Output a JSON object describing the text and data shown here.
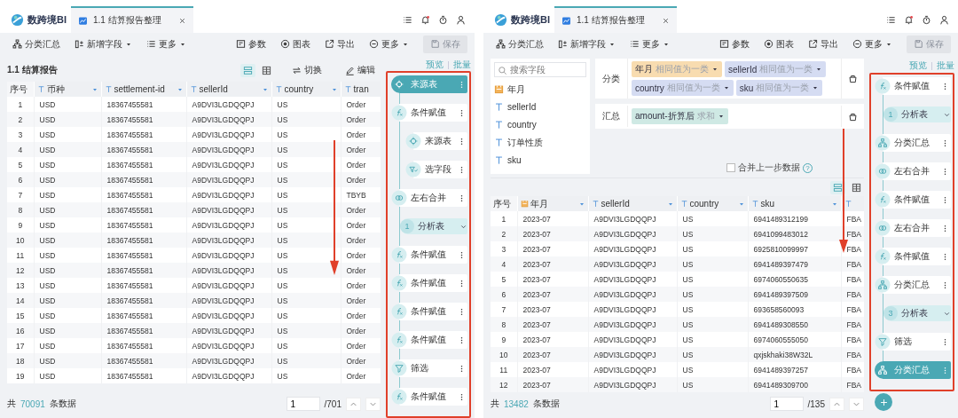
{
  "panels": [
    {
      "app_name": "数跨境BI",
      "tab": {
        "label": "1.1 结算报告整理",
        "selected": true
      },
      "toolbar": {
        "left": [
          {
            "label": "分类汇总",
            "kind": "group",
            "dropdown": false
          },
          {
            "label": "新增字段",
            "kind": "add-field",
            "dropdown": true
          },
          {
            "label": "更多",
            "kind": "more-list",
            "dropdown": true
          }
        ],
        "right": [
          {
            "label": "参数",
            "kind": "params",
            "dropdown": false
          },
          {
            "label": "图表",
            "kind": "chart",
            "dropdown": false
          },
          {
            "label": "导出",
            "kind": "export",
            "dropdown": false
          },
          {
            "label": "更多",
            "kind": "more-circle",
            "dropdown": true
          }
        ],
        "save": {
          "label": "保存",
          "disabled": true
        }
      },
      "report": {
        "title": "1.1 结算报告",
        "actions": [
          {
            "label": "切换",
            "kind": "switch"
          },
          {
            "label": "编辑",
            "kind": "edit"
          }
        ]
      },
      "table": {
        "views": [
          {
            "selected": true
          },
          {
            "selected": false
          }
        ],
        "columns": [
          {
            "label": "序号",
            "kind": "index",
            "menu": false
          },
          {
            "label": "币种",
            "kind": "text",
            "menu": true
          },
          {
            "label": "settlement-id",
            "kind": "text",
            "menu": true
          },
          {
            "label": "sellerId",
            "kind": "text",
            "menu": true
          },
          {
            "label": "country",
            "kind": "text",
            "menu": true
          },
          {
            "label": "tran",
            "kind": "text",
            "menu": false
          }
        ],
        "rows": [
          [
            "1",
            "USD",
            "18367455581",
            "A9DVI3LGDQQPJ",
            "US",
            "Order"
          ],
          [
            "2",
            "USD",
            "18367455581",
            "A9DVI3LGDQQPJ",
            "US",
            "Order"
          ],
          [
            "3",
            "USD",
            "18367455581",
            "A9DVI3LGDQQPJ",
            "US",
            "Order"
          ],
          [
            "4",
            "USD",
            "18367455581",
            "A9DVI3LGDQQPJ",
            "US",
            "Order"
          ],
          [
            "5",
            "USD",
            "18367455581",
            "A9DVI3LGDQQPJ",
            "US",
            "Order"
          ],
          [
            "6",
            "USD",
            "18367455581",
            "A9DVI3LGDQQPJ",
            "US",
            "Order"
          ],
          [
            "7",
            "USD",
            "18367455581",
            "A9DVI3LGDQQPJ",
            "US",
            "TBYB"
          ],
          [
            "8",
            "USD",
            "18367455581",
            "A9DVI3LGDQQPJ",
            "US",
            "Order"
          ],
          [
            "9",
            "USD",
            "18367455581",
            "A9DVI3LGDQQPJ",
            "US",
            "Order"
          ],
          [
            "10",
            "USD",
            "18367455581",
            "A9DVI3LGDQQPJ",
            "US",
            "Order"
          ],
          [
            "11",
            "USD",
            "18367455581",
            "A9DVI3LGDQQPJ",
            "US",
            "Order"
          ],
          [
            "12",
            "USD",
            "18367455581",
            "A9DVI3LGDQQPJ",
            "US",
            "Order"
          ],
          [
            "13",
            "USD",
            "18367455581",
            "A9DVI3LGDQQPJ",
            "US",
            "Order"
          ],
          [
            "14",
            "USD",
            "18367455581",
            "A9DVI3LGDQQPJ",
            "US",
            "Order"
          ],
          [
            "15",
            "USD",
            "18367455581",
            "A9DVI3LGDQQPJ",
            "US",
            "Order"
          ],
          [
            "16",
            "USD",
            "18367455581",
            "A9DVI3LGDQQPJ",
            "US",
            "Order"
          ],
          [
            "17",
            "USD",
            "18367455581",
            "A9DVI3LGDQQPJ",
            "US",
            "Order"
          ],
          [
            "18",
            "USD",
            "18367455581",
            "A9DVI3LGDQQPJ",
            "US",
            "Order"
          ],
          [
            "19",
            "USD",
            "18367455581",
            "A9DVI3LGDQQPJ",
            "US",
            "Order"
          ]
        ]
      },
      "footer": {
        "prefix": "共",
        "count": "70091",
        "suffix": "条数据",
        "page": "1",
        "pages": "/701"
      },
      "flow": {
        "links": [
          "预览",
          "批量"
        ],
        "nodes": [
          {
            "label": "来源表",
            "kind": "source",
            "selected": true
          },
          {
            "label": "条件赋值",
            "kind": "assign",
            "selected": false,
            "children": [
              {
                "label": "来源表",
                "kind": "source",
                "selected": false
              },
              {
                "label": "选字段",
                "kind": "select",
                "selected": false
              }
            ]
          },
          {
            "label": "左右合并",
            "kind": "merge",
            "selected": false
          },
          {
            "label": "分析表",
            "number": "1",
            "kind": "table",
            "selected": false
          },
          {
            "label": "条件赋值",
            "kind": "assign",
            "selected": false
          },
          {
            "label": "条件赋值",
            "kind": "assign",
            "selected": false
          },
          {
            "label": "条件赋值",
            "kind": "assign",
            "selected": false
          },
          {
            "label": "条件赋值",
            "kind": "assign",
            "selected": false
          },
          {
            "label": "筛选",
            "kind": "filter",
            "selected": false
          },
          {
            "label": "条件赋值",
            "kind": "assign",
            "selected": false
          }
        ]
      }
    },
    {
      "app_name": "数跨境BI",
      "tab": {
        "label": "1.1 结算报告整理",
        "selected": true
      },
      "toolbar": {
        "left": [
          {
            "label": "分类汇总",
            "kind": "group",
            "dropdown": false
          },
          {
            "label": "新增字段",
            "kind": "add-field",
            "dropdown": true
          },
          {
            "label": "更多",
            "kind": "more-list",
            "dropdown": true
          }
        ],
        "right": [
          {
            "label": "参数",
            "kind": "params",
            "dropdown": false
          },
          {
            "label": "图表",
            "kind": "chart",
            "dropdown": false
          },
          {
            "label": "导出",
            "kind": "export",
            "dropdown": false
          },
          {
            "label": "更多",
            "kind": "more-circle",
            "dropdown": true
          }
        ],
        "save": {
          "label": "保存",
          "disabled": true
        }
      },
      "fields": {
        "placeholder": "搜索字段",
        "items": [
          {
            "label": "年月",
            "kind": "date"
          },
          {
            "label": "sellerId",
            "kind": "text"
          },
          {
            "label": "country",
            "kind": "text"
          },
          {
            "label": "订单性质",
            "kind": "text"
          },
          {
            "label": "sku",
            "kind": "text"
          }
        ]
      },
      "config": {
        "rows": [
          {
            "label": "分类",
            "chips": [
              {
                "label": "年月",
                "note": "相同值为一类",
                "color": "#f8dcb0"
              },
              {
                "label": "sellerId",
                "note": "相同值为一类",
                "color": "#d5dcf2"
              },
              {
                "label": "country",
                "note": "相同值为一类",
                "color": "#d5dcf2"
              },
              {
                "label": "sku",
                "note": "相同值为一类",
                "color": "#d5dcf2"
              }
            ]
          },
          {
            "label": "汇总",
            "chips": [
              {
                "label": "amount-折算后",
                "note": "求和",
                "color": "#cfe9e4"
              }
            ]
          }
        ],
        "merge": {
          "label": "合并上一步数据",
          "checked": false,
          "help": "?"
        }
      },
      "table": {
        "views": [
          {
            "selected": true
          },
          {
            "selected": false
          }
        ],
        "columns": [
          {
            "label": "序号",
            "kind": "index",
            "menu": false
          },
          {
            "label": "年月",
            "kind": "date",
            "menu": true
          },
          {
            "label": "sellerId",
            "kind": "text",
            "menu": true
          },
          {
            "label": "country",
            "kind": "text",
            "menu": true
          },
          {
            "label": "sku",
            "kind": "text",
            "menu": true
          },
          {
            "kind": "text",
            "menu": false
          }
        ],
        "rows": [
          [
            "1",
            "2023-07",
            "A9DVI3LGDQQPJ",
            "US",
            "6941489312199",
            "FBA"
          ],
          [
            "2",
            "2023-07",
            "A9DVI3LGDQQPJ",
            "US",
            "6941099483012",
            "FBA"
          ],
          [
            "3",
            "2023-07",
            "A9DVI3LGDQQPJ",
            "US",
            "6925810099997",
            "FBA"
          ],
          [
            "4",
            "2023-07",
            "A9DVI3LGDQQPJ",
            "US",
            "6941489397479",
            "FBA"
          ],
          [
            "5",
            "2023-07",
            "A9DVI3LGDQQPJ",
            "US",
            "6974060550635",
            "FBA"
          ],
          [
            "6",
            "2023-07",
            "A9DVI3LGDQQPJ",
            "US",
            "6941489397509",
            "FBA"
          ],
          [
            "7",
            "2023-07",
            "A9DVI3LGDQQPJ",
            "US",
            "693658560093",
            "FBA"
          ],
          [
            "8",
            "2023-07",
            "A9DVI3LGDQQPJ",
            "US",
            "6941489308550",
            "FBA"
          ],
          [
            "9",
            "2023-07",
            "A9DVI3LGDQQPJ",
            "US",
            "6974060555050",
            "FBA"
          ],
          [
            "10",
            "2023-07",
            "A9DVI3LGDQQPJ",
            "US",
            "qxjskhaki38W32L",
            "FBA"
          ],
          [
            "11",
            "2023-07",
            "A9DVI3LGDQQPJ",
            "US",
            "6941489397257",
            "FBA"
          ],
          [
            "12",
            "2023-07",
            "A9DVI3LGDQQPJ",
            "US",
            "6941489309700",
            "FBA"
          ]
        ]
      },
      "footer": {
        "prefix": "共",
        "count": "13482",
        "suffix": "条数据",
        "page": "1",
        "pages": "/135"
      },
      "flow": {
        "links": [
          "预览",
          "批量"
        ],
        "can_add": true,
        "nodes": [
          {
            "label": "条件赋值",
            "kind": "assign",
            "selected": false
          },
          {
            "label": "分析表",
            "number": "1",
            "kind": "table",
            "selected": false
          },
          {
            "label": "分类汇总",
            "kind": "group",
            "selected": false
          },
          {
            "label": "左右合并",
            "kind": "merge",
            "selected": false
          },
          {
            "label": "条件赋值",
            "kind": "assign",
            "selected": false
          },
          {
            "label": "左右合并",
            "kind": "merge",
            "selected": false
          },
          {
            "label": "条件赋值",
            "kind": "assign",
            "selected": false
          },
          {
            "label": "分类汇总",
            "kind": "group",
            "selected": false
          },
          {
            "label": "分析表",
            "number": "3",
            "kind": "table",
            "selected": false
          },
          {
            "label": "筛选",
            "kind": "filter",
            "selected": false
          },
          {
            "label": "分类汇总",
            "kind": "group",
            "selected": true
          }
        ]
      }
    }
  ]
}
